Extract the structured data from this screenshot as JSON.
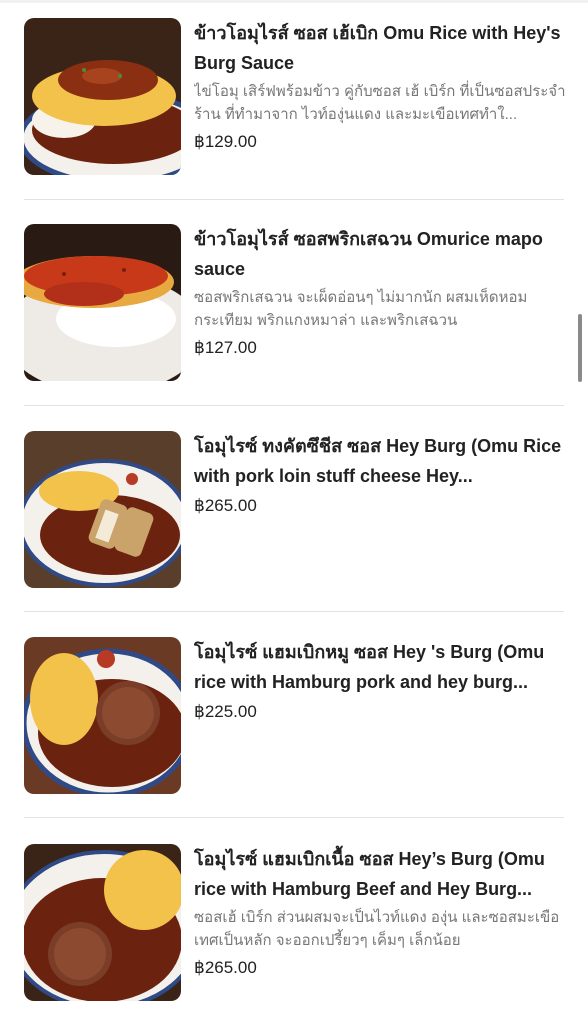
{
  "menu": {
    "items": [
      {
        "title": "ข้าวโอมุไรส์ ซอส เฮ้เบิก Omu Rice with Hey's Burg Sauce",
        "description": "ไข่โอมุ เสิร์ฟพร้อมข้าว คู่กับซอส เฮ้ เบิร์ก ที่เป็นซอสประจำร้าน ที่ทำมาจาก ไวท์องุ่นแดง และมะเขือเทศทำใ...",
        "price": "฿129.00"
      },
      {
        "title": "ข้าวโอมุไรส์ ซอสพริกเสฉวน Omurice mapo sauce",
        "description": "ซอสพริกเสฉวน จะเผ็ดอ่อนๆ ไม่มากนัก ผสมเห็ดหอม กระเทียม พริกแกงหมาล่า และพริกเสฉวน",
        "price": "฿127.00"
      },
      {
        "title": "โอมุไรซ์ ทงคัตซึชีส ซอส Hey Burg (Omu Rice with pork loin stuff cheese Hey...",
        "description": "",
        "price": "฿265.00"
      },
      {
        "title": "โอมุไรซ์ แฮมเบิกหมู ซอส Hey 's Burg (Omu rice with Hamburg pork and hey burg...",
        "description": "",
        "price": "฿225.00"
      },
      {
        "title": "โอมุไรซ์ แฮมเบิกเนื้อ ซอส Hey’s Burg (Omu rice with Hamburg Beef and Hey Burg...",
        "description": "ซอสเฮ้ เบิร์ก ส่วนผสมจะเป็นไวท์แดง องุ่น และซอสมะเขือเทศเป็นหลัก จะออกเปรี้ยวๆ เค็มๆ เล็กน้อย",
        "price": "฿265.00"
      }
    ]
  },
  "colors": {
    "background": "#ffffff",
    "divider": "#e2e2e2",
    "title": "#222222",
    "description": "#777777",
    "sauce": "#6b2310",
    "egg": "#f2c24a"
  }
}
